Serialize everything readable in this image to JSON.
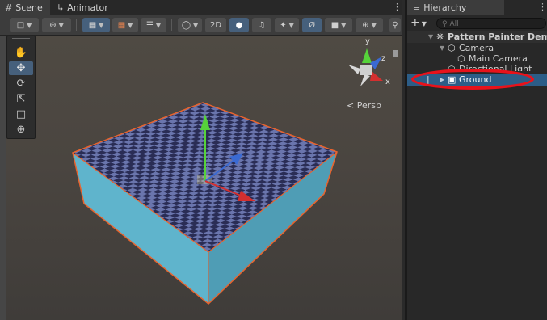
{
  "scene": {
    "tabs": [
      {
        "icon": "grid-icon",
        "label": "Scene"
      },
      {
        "icon": "animator-icon",
        "label": "Animator"
      }
    ],
    "toolbar": {
      "mode_2d_label": "2D"
    },
    "tools": [
      "hand-tool-icon",
      "move-tool-icon",
      "rotate-tool-icon",
      "scale-tool-icon",
      "rect-tool-icon",
      "transform-tool-icon"
    ],
    "gizmo_axes": {
      "y": "y",
      "z": "z",
      "x": "x"
    },
    "persp_label": "< Persp",
    "colors": {
      "selection_outline": "#e8642e",
      "box_side": "#5fb4cc",
      "checker_dark": "#2a2d55",
      "checker_light": "#6a75ad"
    }
  },
  "hierarchy": {
    "tab_label": "Hierarchy",
    "add_label": "+",
    "search_placeholder": "All",
    "rows": [
      {
        "label": "Pattern Painter Demo",
        "icon": "unity-scene-icon"
      },
      {
        "label": "Camera",
        "icon": "gameobject-icon"
      },
      {
        "label": "Main Camera",
        "icon": "gameobject-icon"
      },
      {
        "label": "Directional Light",
        "icon": "gameobject-icon"
      },
      {
        "label": "Ground",
        "icon": "cube-icon"
      }
    ],
    "highlight_color": "#e8121b"
  }
}
